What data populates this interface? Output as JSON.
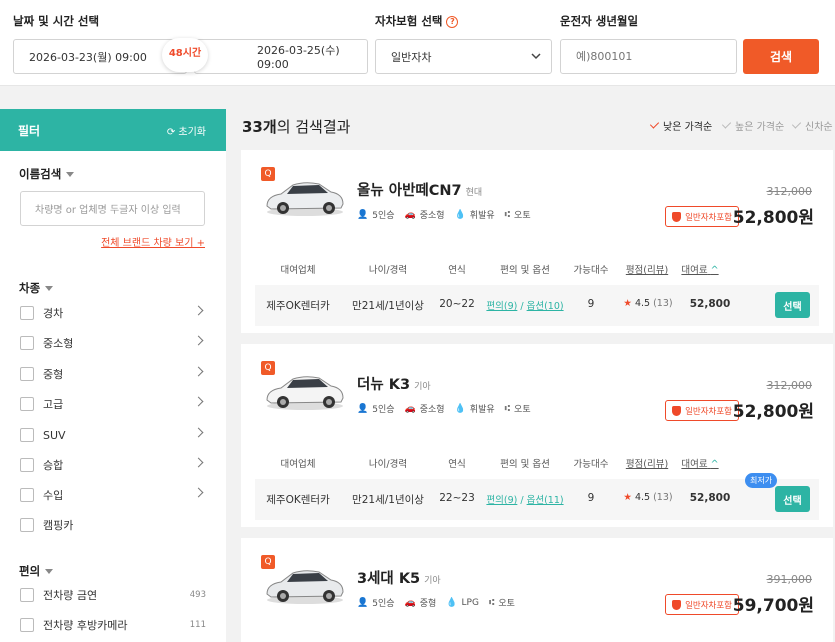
{
  "search": {
    "date_label": "날짜 및 시간 선택",
    "pickup": "2026-03-23(월) 09:00",
    "duration": "48시간",
    "return": "2026-03-25(수) 09:00",
    "insurance_label": "자차보험 선택",
    "insurance_value": "일반자차",
    "birth_label": "운전자 생년월일",
    "birth_placeholder": "예)800101",
    "search_button": "검색"
  },
  "filter": {
    "title": "필터",
    "reset": "초기화",
    "name_search_label": "이름검색",
    "name_search_placeholder": "차량명 or 업체명 두글자 이상 입력",
    "brand_link": "전체 브랜드 차량 보기 +",
    "car_type_label": "차종",
    "car_types": [
      "경차",
      "중소형",
      "중형",
      "고급",
      "SUV",
      "승합",
      "수입",
      "캠핑카"
    ],
    "convenience_label": "편의",
    "convenience": [
      {
        "label": "전차량 금연",
        "count": "493"
      },
      {
        "label": "전차량 후방카메라",
        "count": "111"
      }
    ]
  },
  "results": {
    "count": "33개",
    "suffix": "의 검색결과",
    "sort": [
      "낮은 가격순",
      "높은 가격순",
      "신차순"
    ],
    "table_headers": [
      "대여업체",
      "나이/경력",
      "연식",
      "편의 및 옵션",
      "가능대수",
      "평점(리뷰)",
      "대여료"
    ],
    "cars": [
      {
        "name": "올뉴 아반떼CN7",
        "maker": "현대",
        "seats": "5인승",
        "size": "중소형",
        "fuel": "휘발유",
        "trans": "오토",
        "orig_price": "312,000",
        "price": "52,800원",
        "insurance": "일반자차포함",
        "row": {
          "company": "제주OK렌터카",
          "age": "만21세/1년이상",
          "year": "20~22",
          "options_a": "편의(9)",
          "options_b": "옵션(10)",
          "avail": "9",
          "rating": "4.5",
          "reviews": "(13)",
          "fee": "52,800",
          "select": "선택",
          "badge": ""
        }
      },
      {
        "name": "더뉴 K3",
        "maker": "기아",
        "seats": "5인승",
        "size": "중소형",
        "fuel": "휘발유",
        "trans": "오토",
        "orig_price": "312,000",
        "price": "52,800원",
        "insurance": "일반자차포함",
        "row": {
          "company": "제주OK렌터카",
          "age": "만21세/1년이상",
          "year": "22~23",
          "options_a": "편의(9)",
          "options_b": "옵션(11)",
          "avail": "9",
          "rating": "4.5",
          "reviews": "(13)",
          "fee": "52,800",
          "select": "선택",
          "badge": "최저가"
        }
      },
      {
        "name": "3세대 K5",
        "maker": "기아",
        "seats": "5인승",
        "size": "중형",
        "fuel": "LPG",
        "trans": "오토",
        "orig_price": "391,000",
        "price": "59,700원",
        "insurance": "일반자차포함"
      }
    ]
  },
  "colors": {
    "accent": "#f05a28",
    "teal": "#2db4a4",
    "badge_blue": "#3d8ef0"
  }
}
